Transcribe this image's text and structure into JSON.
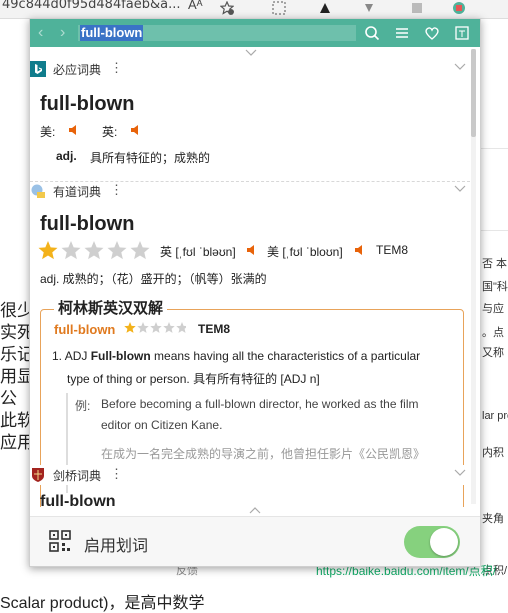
{
  "background": {
    "url_fragment": "49c844d0f95d484faeb&a...",
    "read_aloud": "Aᴬ",
    "left_text": [
      "很少",
      "实死于",
      "乐记",
      "用显",
      "公",
      "此软",
      "应用。"
    ],
    "bottom_left": "Scalar product)，是高中数学",
    "feedback": "反馈",
    "right_col": [
      "否 本",
      "国\"科",
      "与应",
      "。点",
      "又称",
      "lar pro",
      "内积",
      "夹角",
      "点积/"
    ],
    "link": "https://baike.baidu.com/item/点积/"
  },
  "popup": {
    "search": {
      "query": "full-blown"
    },
    "sections": {
      "bing": {
        "name": "必应词典",
        "more": "⋮",
        "word": "full-blown",
        "pron_us_label": "美:",
        "pron_uk_label": "英:",
        "pos": "adj.",
        "definition": "具所有特征的；成熟的"
      },
      "youdao": {
        "name": "有道词典",
        "more": "⋮",
        "word": "full-blown",
        "rating_stars": 1,
        "rating_max": 5,
        "uk_phonetic": "英 [ˌfʊl ˈbləʊn]",
        "us_phonetic": "美 [ˌfʊl ˈbloʊn]",
        "exam_tag": "TEM8",
        "definition": "adj. 成熟的；（花）盛开的；（帆等）张满的",
        "collins": {
          "title": "柯林斯英汉双解",
          "headword": "full-blown",
          "rating_stars": 1,
          "rating_max": 5,
          "exam_tag": "TEM8",
          "sense_number": "1.",
          "sense_type": "ADJ",
          "sense_headword": "Full-blown",
          "sense_text_a": "means having all the characteristics of a particular",
          "sense_text_b": "type of thing or person. 具有所有特征的 [ADJ n]",
          "example_label": "例:",
          "example_en_a": "Before becoming a full-blown director, he worked as the film",
          "example_en_b": "editor on Citizen Kane.",
          "example_zh": "在成为一名完全成熟的导演之前，他曾担任影片《公民凯恩》"
        }
      },
      "cambridge": {
        "name": "剑桥词典",
        "more": "⋮",
        "word": "full-blown"
      }
    },
    "footer": {
      "label": "启用划词",
      "toggle_on": true
    }
  },
  "colors": {
    "accent": "#4fb29a",
    "toggle": "#86d17e",
    "collins_border": "#e8a35a",
    "collins_word": "#e07a1f",
    "star_active": "#f3b21b",
    "star_inactive": "#cfcfcf"
  }
}
